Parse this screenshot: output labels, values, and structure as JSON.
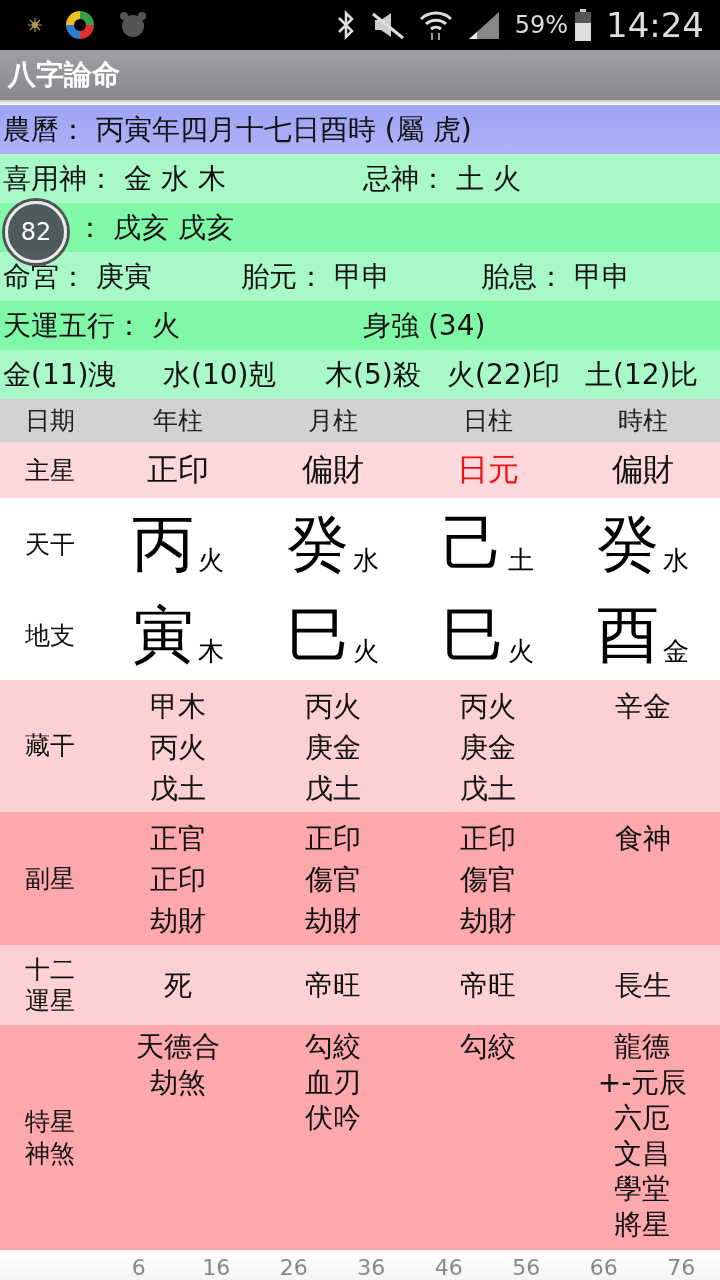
{
  "status_bar": {
    "battery": "59%",
    "time": "14:24"
  },
  "window": {
    "title": "八字論命"
  },
  "info_rows": [
    {
      "kind": "lunar",
      "cells": [
        "農曆： 丙寅年四月十七日酉時 (屬 虎)"
      ]
    },
    {
      "kind": "light",
      "cells": [
        "喜用神： 金 水 木",
        "忌神： 土 火"
      ]
    },
    {
      "kind": "dark",
      "cells": [
        "： 戌亥 戌亥"
      ]
    },
    {
      "kind": "light",
      "cells": [
        "命宮： 庚寅",
        "胎元： 甲申",
        "胎息： 甲申"
      ]
    },
    {
      "kind": "dark",
      "cells": [
        "天運五行： 火",
        "身強 (34)"
      ]
    },
    {
      "kind": "light",
      "cells": [
        "金(11)洩",
        "水(10)剋",
        "木(5)殺",
        "火(22)印",
        "土(12)比"
      ]
    }
  ],
  "floating_badge": "82",
  "table": {
    "columns": [
      "日期",
      "年柱",
      "月柱",
      "日柱",
      "時柱"
    ],
    "main_star": {
      "label": "主星",
      "cells": [
        {
          "text": "正印",
          "emphasized": false
        },
        {
          "text": "偏財",
          "emphasized": false
        },
        {
          "text": "日元",
          "emphasized": true
        },
        {
          "text": "偏財",
          "emphasized": false
        }
      ]
    },
    "stems": {
      "label": "天干",
      "cells": [
        {
          "char": "丙",
          "element": "火"
        },
        {
          "char": "癸",
          "element": "水"
        },
        {
          "char": "己",
          "element": "土"
        },
        {
          "char": "癸",
          "element": "水"
        }
      ]
    },
    "branches": {
      "label": "地支",
      "cells": [
        {
          "char": "寅",
          "element": "木"
        },
        {
          "char": "巳",
          "element": "火"
        },
        {
          "char": "巳",
          "element": "火"
        },
        {
          "char": "酉",
          "element": "金"
        }
      ]
    },
    "list_rows": [
      {
        "kind": "pale",
        "label": "藏干",
        "cells": [
          [
            "甲木",
            "丙火",
            "戊土"
          ],
          [
            "丙火",
            "庚金",
            "戊土"
          ],
          [
            "丙火",
            "庚金",
            "戊土"
          ],
          [
            "辛金"
          ]
        ]
      },
      {
        "kind": "deep",
        "label": "副星",
        "cells": [
          [
            "正官",
            "正印",
            "劫財"
          ],
          [
            "正印",
            "傷官",
            "劫財"
          ],
          [
            "正印",
            "傷官",
            "劫財"
          ],
          [
            "食神"
          ]
        ]
      },
      {
        "kind": "pale",
        "label": "十二運星",
        "cells": [
          [
            "死"
          ],
          [
            "帝旺"
          ],
          [
            "帝旺"
          ],
          [
            "長生"
          ]
        ]
      },
      {
        "kind": "deep",
        "label": "特星神煞",
        "cells": [
          [
            "天德合",
            "劫煞"
          ],
          [
            "勾絞",
            "血刃",
            "伏吟"
          ],
          [
            "勾絞"
          ],
          [
            "龍德",
            "+-元辰",
            "六厄",
            "文昌",
            "學堂",
            "將星"
          ]
        ]
      }
    ],
    "ages": [
      "6",
      "16",
      "26",
      "36",
      "46",
      "56",
      "66",
      "76"
    ]
  }
}
